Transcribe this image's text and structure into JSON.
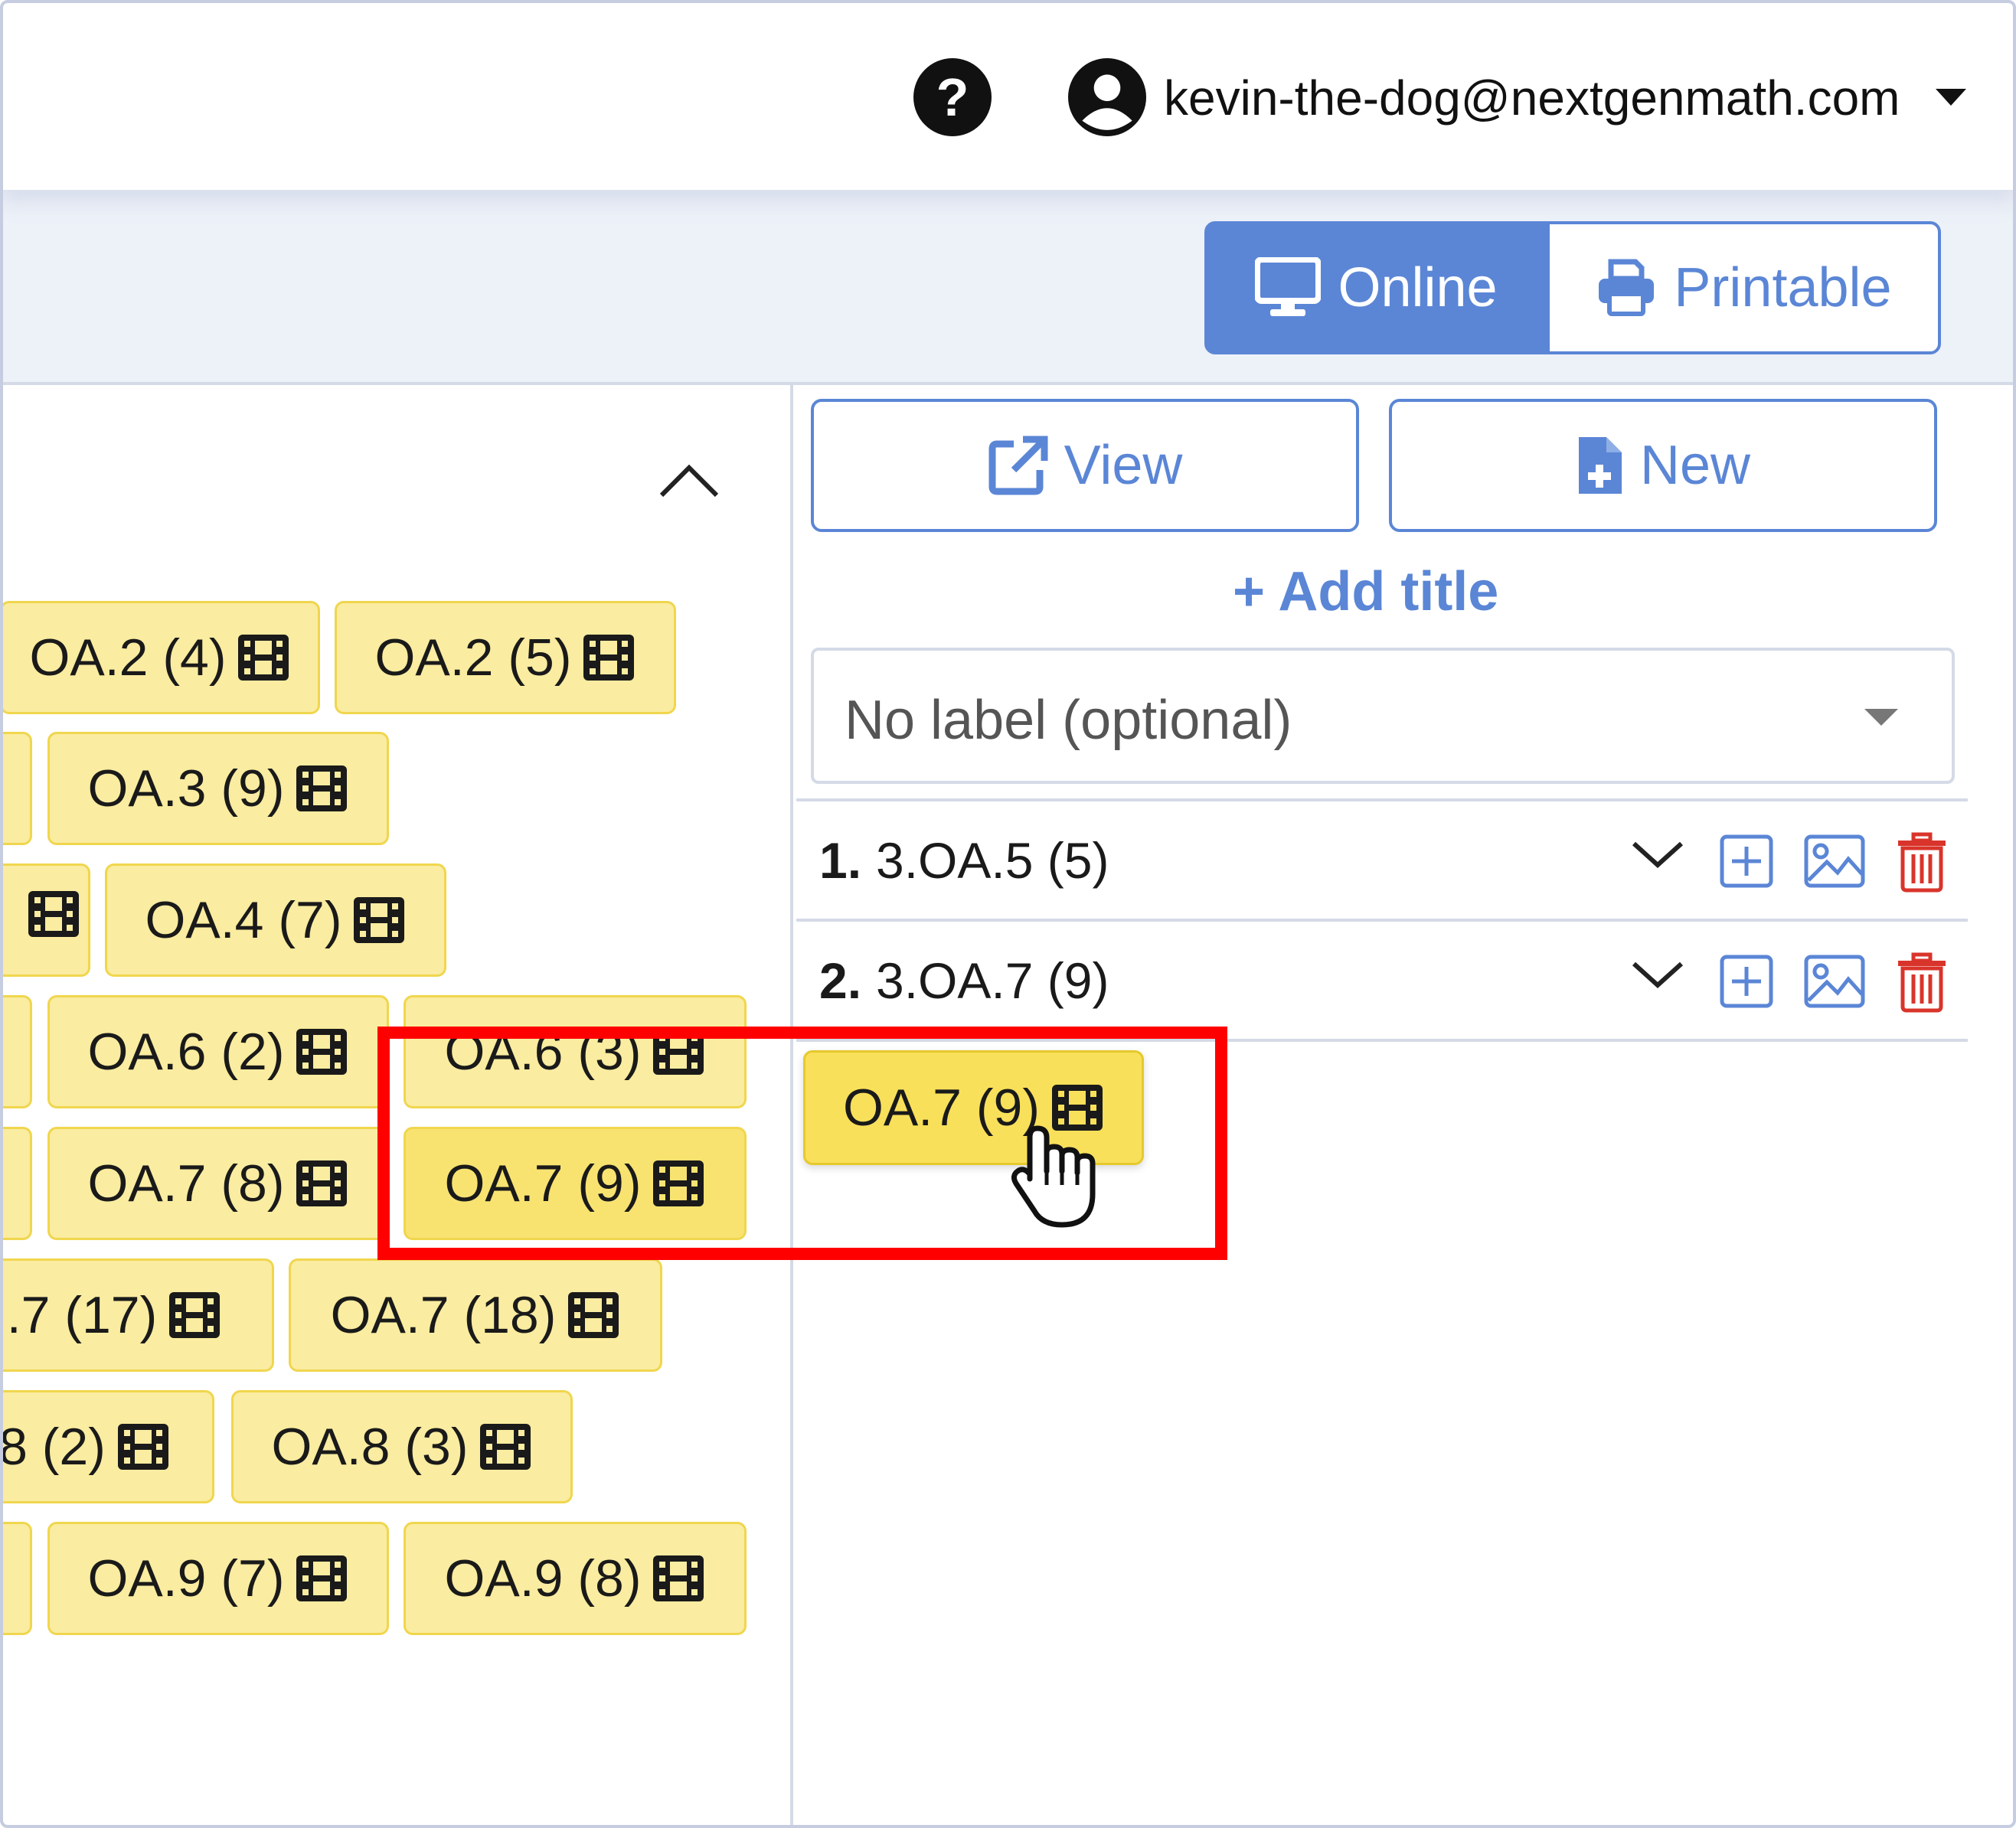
{
  "header": {
    "help_icon": "question-circle-icon",
    "help_glyph": "?",
    "user_email": "kevin-the-dog@nextgenmath.com",
    "user_icon": "user-circle-icon",
    "menu_caret": "caret-down-icon"
  },
  "mode_toggle": {
    "online_label": "Online",
    "printable_label": "Printable",
    "selected": "Online"
  },
  "tag_bank": {
    "collapse_icon": "chevron-up-icon",
    "tags": [
      {
        "label": "OA.2 (4)"
      },
      {
        "label": "OA.2 (5)"
      },
      {
        "label": "OA.3 (9)"
      },
      {
        "label": "OA.4 (7)"
      },
      {
        "label": "OA.6 (2)"
      },
      {
        "label": "OA.6 (3)"
      },
      {
        "label": "OA.7 (8)"
      },
      {
        "label": "OA.7 (9)",
        "selected": true
      },
      {
        "label": ".7 (17)"
      },
      {
        "label": "OA.7 (18)"
      },
      {
        "label": "8 (2)"
      },
      {
        "label": "OA.8 (3)"
      },
      {
        "label": "OA.9 (7)"
      },
      {
        "label": "OA.9 (8)"
      }
    ]
  },
  "assignment": {
    "view_label": "View",
    "new_label": "New",
    "add_title_label": "+ Add title",
    "label_placeholder": "No label (optional)",
    "questions": [
      {
        "num": "1.",
        "text": "3.OA.5 (5)"
      },
      {
        "num": "2.",
        "text": "3.OA.7 (9)"
      }
    ],
    "dragged_tag": "OA.7 (9)"
  },
  "colors": {
    "accent": "#5b86d6",
    "tag_fill": "#faeca0",
    "tag_border": "#f0d64e",
    "highlight": "#ff0000",
    "trash": "#d9342b"
  }
}
